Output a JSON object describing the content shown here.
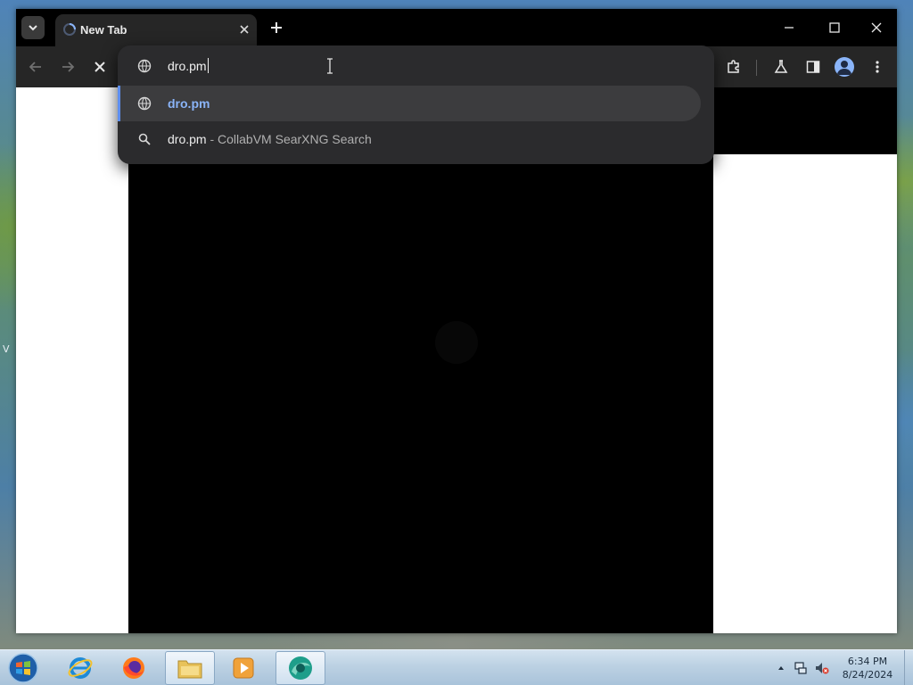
{
  "browser": {
    "tab": {
      "title": "New Tab"
    },
    "omnibox": {
      "value": "dro.pm"
    },
    "suggestions": [
      {
        "icon": "globe-icon",
        "text": "dro.pm"
      },
      {
        "icon": "search-icon",
        "text": "dro.pm",
        "separator": " - ",
        "description": "CollabVM SearXNG Search"
      }
    ]
  },
  "desktop": {
    "side_glyph": "V"
  },
  "taskbar": {
    "apps": [
      "windows-start-orb",
      "internet-explorer",
      "firefox",
      "file-explorer",
      "media-player",
      "browser"
    ],
    "clock": {
      "time": "6:34 PM",
      "date": "8/24/2024"
    }
  },
  "colors": {
    "accent": "#8ab4f8",
    "selection_bar": "#5e8ff0",
    "omnibox_bg": "#2b2b2d",
    "toolbar_bg": "#262626"
  }
}
